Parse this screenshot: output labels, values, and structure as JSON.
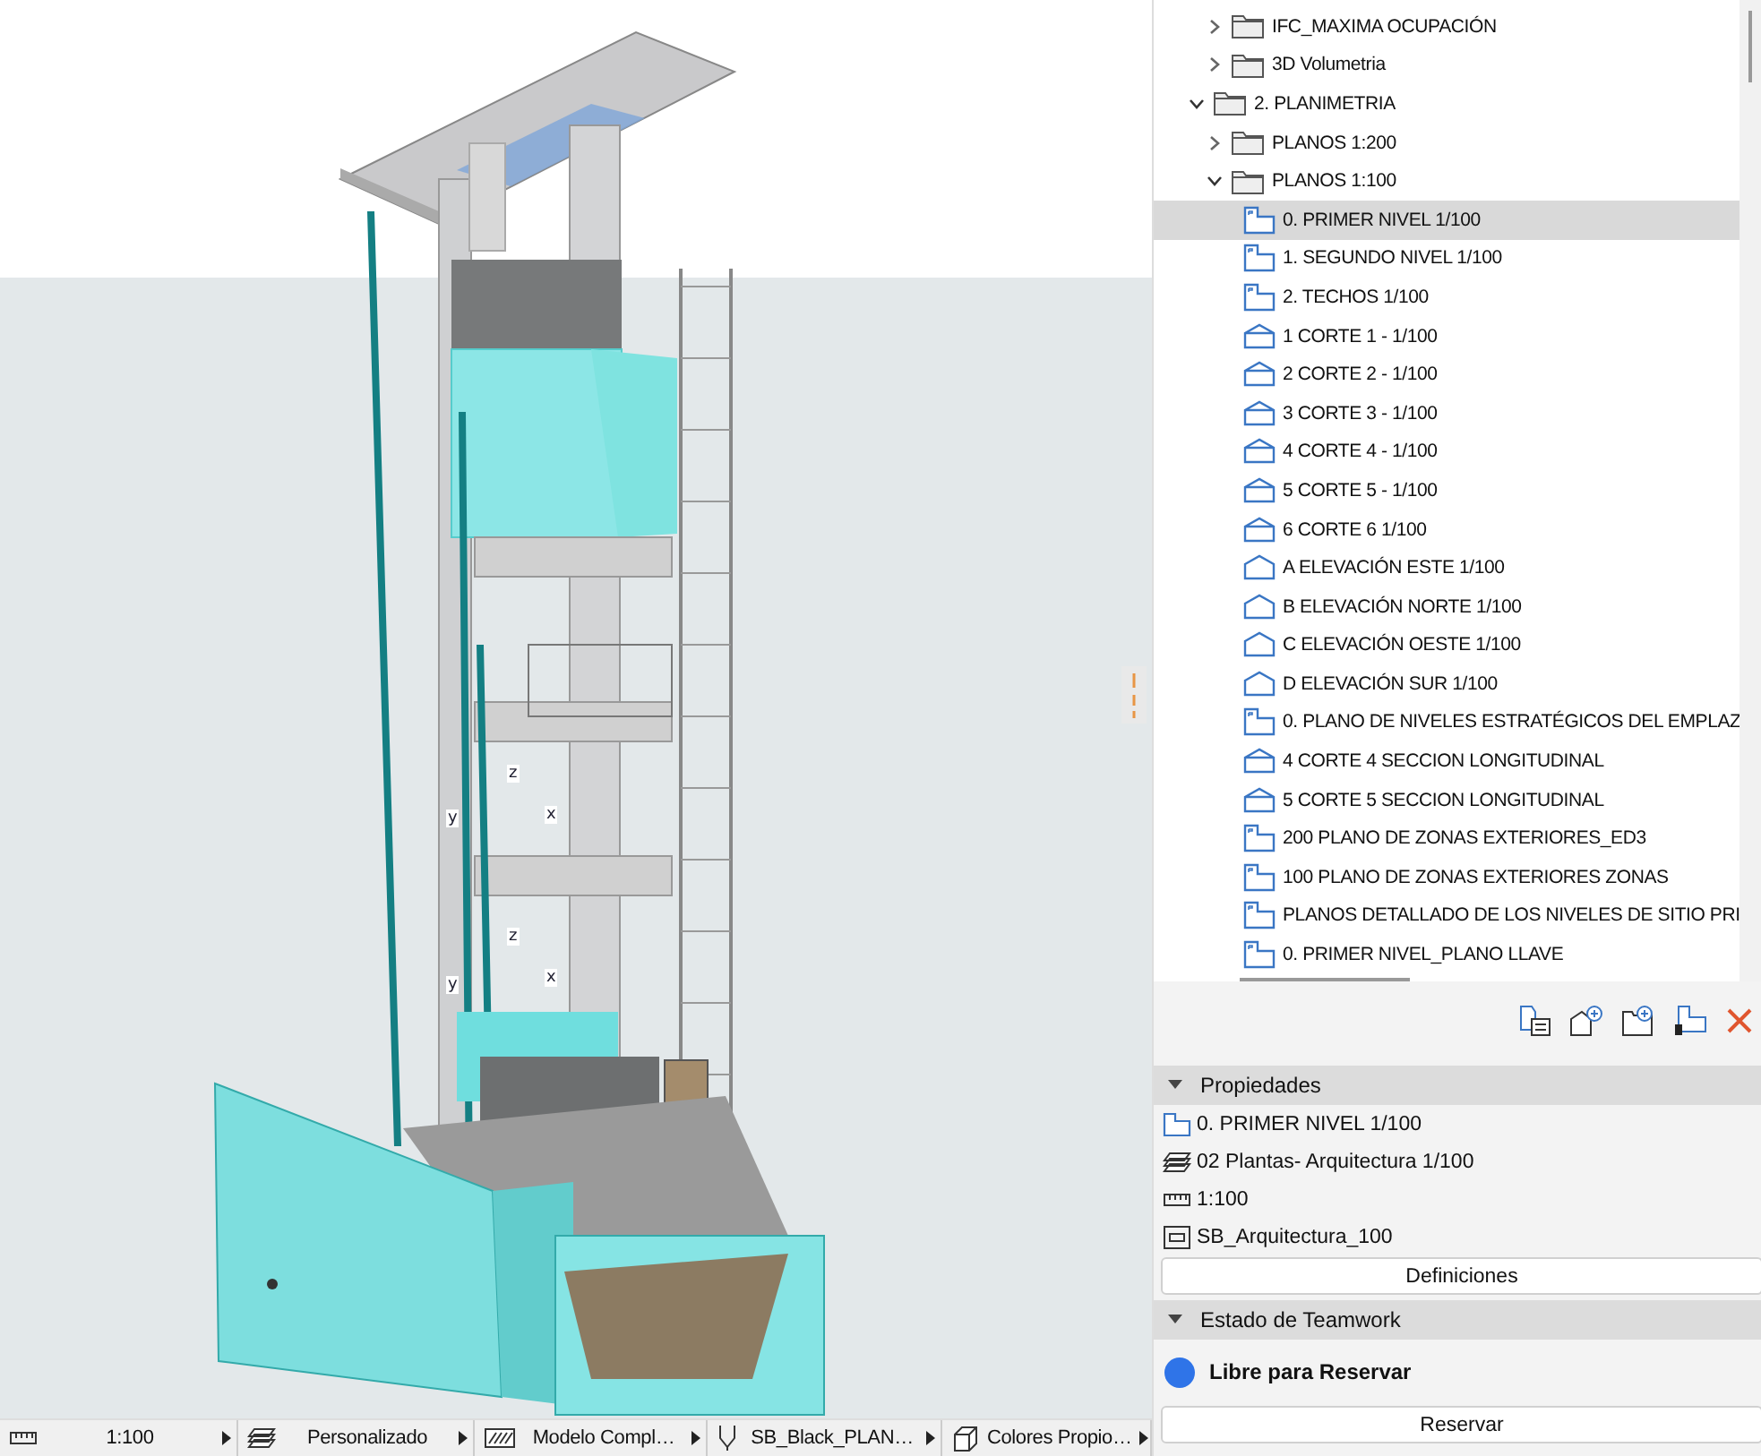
{
  "viewport": {
    "axis_markers": [
      [
        "z",
        "y",
        "x"
      ],
      [
        "z",
        "y",
        "x"
      ]
    ]
  },
  "navigator": {
    "tree": [
      {
        "children": [
          {
            "label": "IFC_MAXIMA OCUPACIÓN",
            "kind": "folder",
            "expanded": false,
            "selected": false
          },
          {
            "label": "3D Volumetria",
            "kind": "folder",
            "expanded": false,
            "selected": false
          }
        ]
      },
      {
        "label": "2. PLANIMETRIA",
        "kind": "folder",
        "expanded": true,
        "selected": false,
        "children": [
          {
            "label": "PLANOS 1:200",
            "kind": "folder",
            "expanded": false,
            "selected": false
          },
          {
            "label": "PLANOS 1:100",
            "kind": "folder",
            "expanded": true,
            "selected": false,
            "children": [
              {
                "label": "0. PRIMER NIVEL 1/100",
                "kind": "plan",
                "selected": true
              },
              {
                "label": "1. SEGUNDO NIVEL 1/100",
                "kind": "plan",
                "selected": false
              },
              {
                "label": "2. TECHOS 1/100",
                "kind": "plan",
                "selected": false
              },
              {
                "label": "1 CORTE 1 - 1/100",
                "kind": "section",
                "selected": false
              },
              {
                "label": "2 CORTE 2 - 1/100",
                "kind": "section",
                "selected": false
              },
              {
                "label": "3 CORTE 3 - 1/100",
                "kind": "section",
                "selected": false
              },
              {
                "label": "4 CORTE 4 - 1/100",
                "kind": "section",
                "selected": false
              },
              {
                "label": "5 CORTE 5 - 1/100",
                "kind": "section",
                "selected": false
              },
              {
                "label": "6 CORTE 6 1/100",
                "kind": "section",
                "selected": false
              },
              {
                "label": "A ELEVACIÓN ESTE 1/100",
                "kind": "elevation",
                "selected": false
              },
              {
                "label": "B ELEVACIÓN NORTE 1/100",
                "kind": "elevation",
                "selected": false
              },
              {
                "label": "C ELEVACIÓN OESTE 1/100",
                "kind": "elevation",
                "selected": false
              },
              {
                "label": "D ELEVACIÓN SUR 1/100",
                "kind": "elevation",
                "selected": false
              },
              {
                "label": "0. PLANO DE NIVELES ESTRATÉGICOS DEL EMPLAZ",
                "kind": "plan",
                "selected": false
              },
              {
                "label": "4 CORTE 4 SECCION LONGITUDINAL",
                "kind": "section",
                "selected": false
              },
              {
                "label": "5 CORTE 5 SECCION LONGITUDINAL",
                "kind": "section",
                "selected": false
              },
              {
                "label": "200 PLANO DE ZONAS EXTERIORES_ED3",
                "kind": "plan",
                "selected": false
              },
              {
                "label": "100 PLANO DE ZONAS EXTERIORES ZONAS",
                "kind": "plan",
                "selected": false
              },
              {
                "label": "PLANOS DETALLADO DE LOS NIVELES DE SITIO PRI",
                "kind": "plan",
                "selected": false
              },
              {
                "label": "0. PRIMER NIVEL_PLANO LLAVE",
                "kind": "plan",
                "selected": false
              }
            ]
          }
        ]
      }
    ]
  },
  "properties": {
    "title": "Propiedades",
    "expanded": true,
    "rows": [
      {
        "kind": "view",
        "text": "0. PRIMER NIVEL 1/100"
      },
      {
        "kind": "layers",
        "text": "02 Plantas- Arquitectura 1/100"
      },
      {
        "kind": "scale",
        "text": "1:100"
      },
      {
        "kind": "layout",
        "text": "SB_Arquitectura_100"
      }
    ],
    "button": "Definiciones"
  },
  "teamwork": {
    "title": "Estado de Teamwork",
    "expanded": true,
    "status": {
      "text": "Libre para Reservar",
      "color": "#2f74e8"
    },
    "button": "Reservar"
  },
  "status_bar": [
    {
      "kind": "scale",
      "text": "1:100"
    },
    {
      "kind": "layers",
      "text": "Personalizado"
    },
    {
      "kind": "model",
      "text": "Modelo Compl…"
    },
    {
      "kind": "pen",
      "text": "SB_Black_PLAN…"
    },
    {
      "kind": "cube",
      "text": "Colores Propio…"
    }
  ]
}
